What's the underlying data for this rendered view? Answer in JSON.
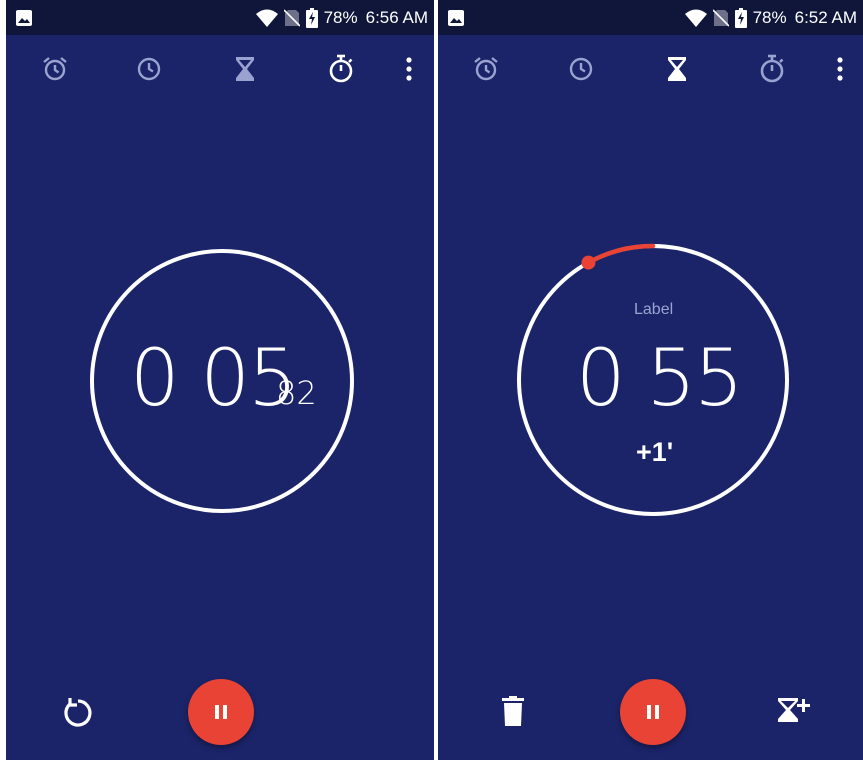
{
  "colors": {
    "background": "#1b2469",
    "status_bar": "#0f163a",
    "accent_red": "#e84334",
    "icon_dim": "#9aa2cf",
    "label_gray": "#9ba3d1"
  },
  "left_screen": {
    "status": {
      "battery": "78%",
      "time": "6:56 AM"
    },
    "tabs": [
      {
        "name": "alarm",
        "icon": "alarm-clock-icon",
        "active": false
      },
      {
        "name": "clock",
        "icon": "clock-icon",
        "active": false
      },
      {
        "name": "timer",
        "icon": "hourglass-icon",
        "active": false
      },
      {
        "name": "stopwatch",
        "icon": "stopwatch-icon",
        "active": true
      }
    ],
    "stopwatch": {
      "main": "0 05",
      "hundredths": "82"
    },
    "controls": {
      "left": "reset-icon",
      "center": "pause-icon"
    }
  },
  "right_screen": {
    "status": {
      "battery": "78%",
      "time": "6:52 AM"
    },
    "tabs": [
      {
        "name": "alarm",
        "icon": "alarm-clock-icon",
        "active": false
      },
      {
        "name": "clock",
        "icon": "clock-icon",
        "active": false
      },
      {
        "name": "timer",
        "icon": "hourglass-icon",
        "active": true
      },
      {
        "name": "stopwatch",
        "icon": "stopwatch-icon",
        "active": false
      }
    ],
    "timer": {
      "label": "Label",
      "main": "0 55",
      "add_minute": "+1'",
      "elapsed_fraction": 0.08
    },
    "controls": {
      "left": "delete-icon",
      "center": "pause-icon",
      "right": "add-timer-icon"
    }
  }
}
